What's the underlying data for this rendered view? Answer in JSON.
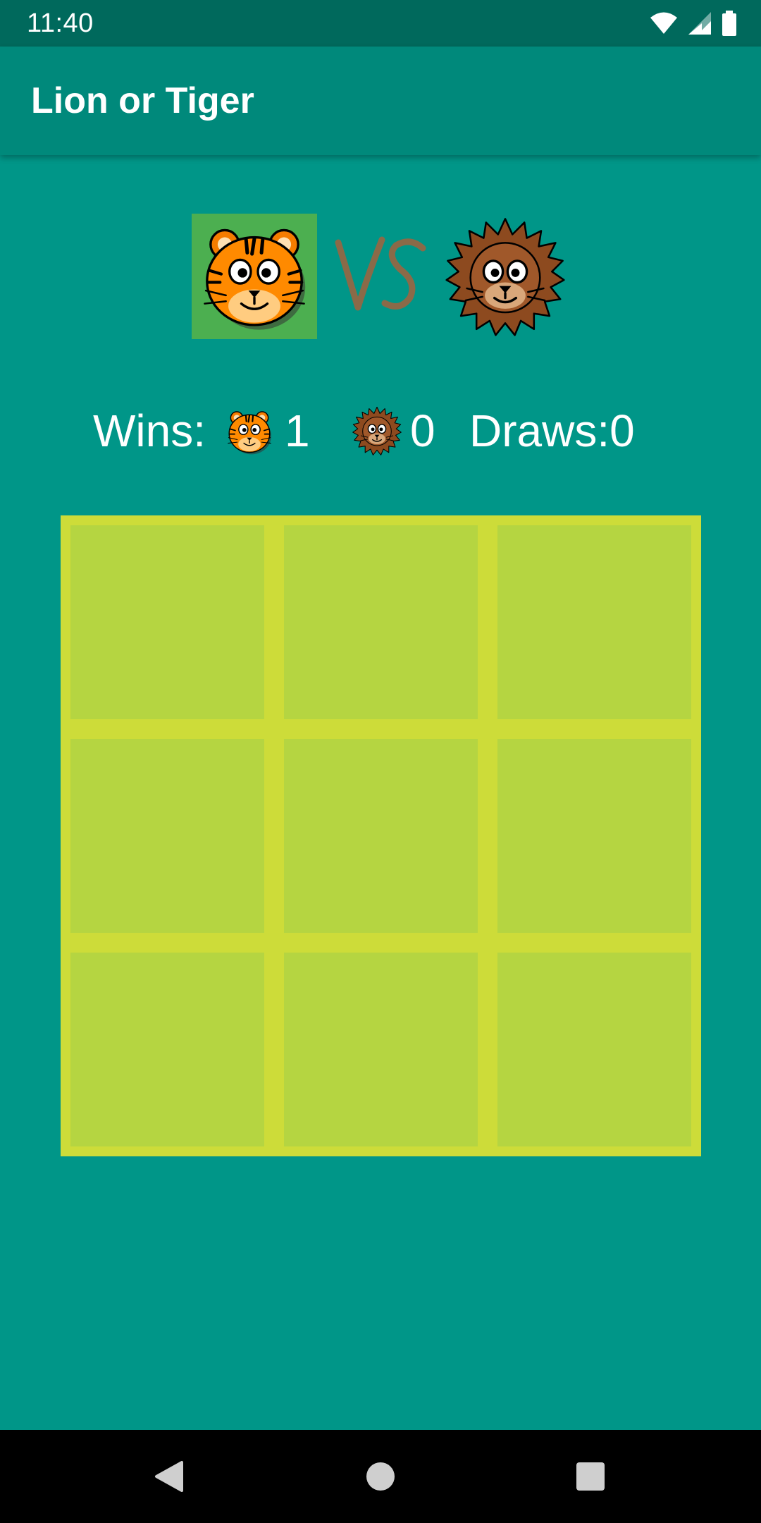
{
  "status_bar": {
    "time": "11:40",
    "icons": [
      "wifi-icon",
      "cell-signal-icon",
      "battery-icon"
    ]
  },
  "app_bar": {
    "title": "Lion or Tiger"
  },
  "players": {
    "current_turn": "tiger",
    "tiger_icon": "tiger-face-icon",
    "lion_icon": "lion-face-icon",
    "vs_label": "VS",
    "vs_color": "#8a6a48"
  },
  "scoreboard": {
    "wins_label": "Wins:",
    "tiger_wins": "1",
    "lion_wins": "0",
    "draws_label": "Draws:0"
  },
  "board": {
    "cells": [
      "",
      "",
      "",
      "",
      "",
      "",
      "",
      "",
      ""
    ]
  },
  "nav_bar": {
    "buttons": [
      "back-icon",
      "home-icon",
      "recents-icon"
    ]
  },
  "colors": {
    "background": "#009688",
    "app_bar": "#00897b",
    "status_bar": "#00695c",
    "board_frame": "#cddc39",
    "board_cell": "#b5d541",
    "active_player": "#4caf50"
  }
}
